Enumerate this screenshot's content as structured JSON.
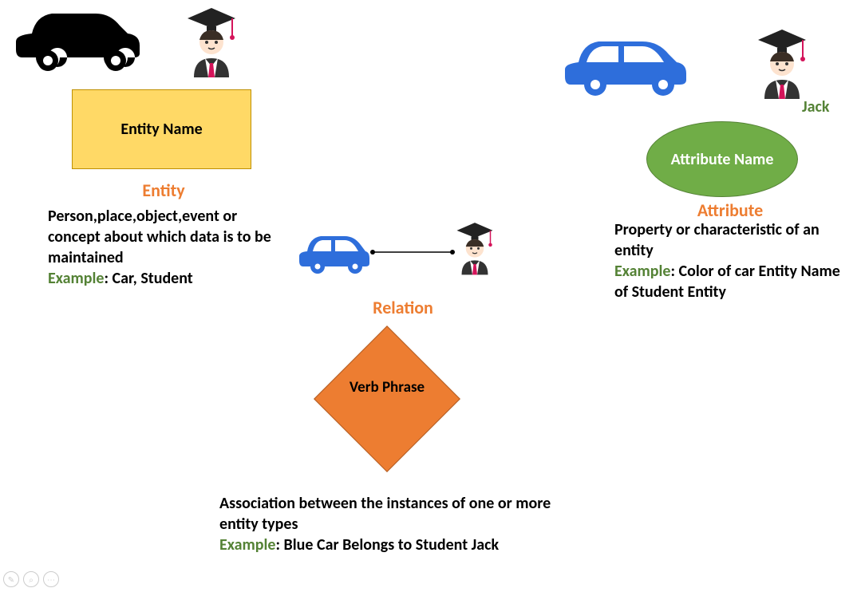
{
  "entity": {
    "box_label": "Entity Name",
    "title": "Entity",
    "desc": "Person,place,object,event or concept about which data is to be maintained",
    "example_label": "Example",
    "example_text": ": Car, Student"
  },
  "attribute": {
    "name_tag": "Jack",
    "ellipse_label": "Attribute Name",
    "title": "Attribute",
    "desc": "Property or characteristic of an entity",
    "example_label": "Example",
    "example_text": ": Color of car Entity Name of Student Entity"
  },
  "relation": {
    "title": "Relation",
    "diamond_label": "Verb Phrase",
    "desc": "Association between the instances of one or more entity types",
    "example_label": "Example",
    "example_text": ": Blue Car Belongs to Student Jack"
  }
}
